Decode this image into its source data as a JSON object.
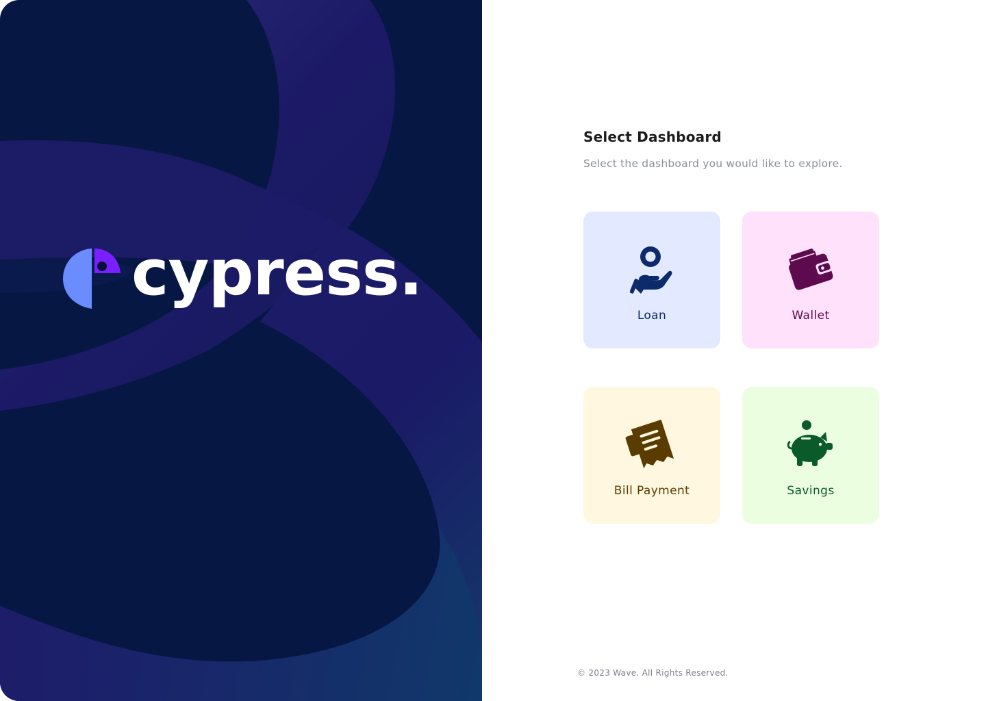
{
  "brand": {
    "name": "cypress.",
    "logo_icon": "cypress-bird-logo-icon"
  },
  "header": {
    "title": "Select Dashboard",
    "subtitle": "Select the dashboard you would like to explore."
  },
  "dashboards": [
    {
      "label": "Loan",
      "icon": "hand-coin-icon",
      "text_color": "#0d2a6b",
      "bg_color": "#e3e9ff"
    },
    {
      "label": "Wallet",
      "icon": "wallet-icon",
      "text_color": "#5e0a4f",
      "bg_color": "#ffe1fb"
    },
    {
      "label": "Bill Payment",
      "icon": "receipt-icon",
      "text_color": "#5a3c00",
      "bg_color": "#fff7df"
    },
    {
      "label": "Savings",
      "icon": "piggy-bank-icon",
      "text_color": "#0b5a2a",
      "bg_color": "#ebffe0"
    }
  ],
  "footer": {
    "copyright": "© 2023 Wave. All Rights Reserved."
  },
  "colors": {
    "hero_bg": "#061744",
    "ribbon": "#1c1a66",
    "logo_blue": "#6b8cff",
    "logo_purple": "#7a1fff"
  }
}
